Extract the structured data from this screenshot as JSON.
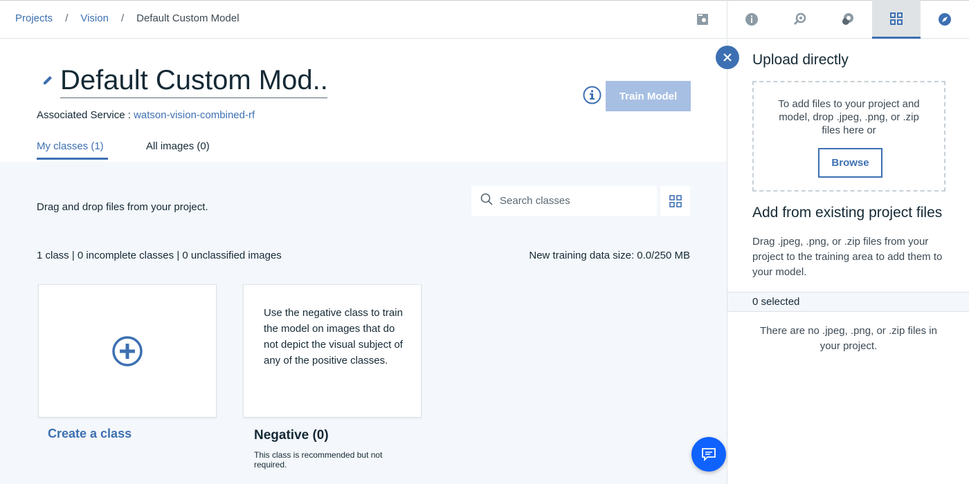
{
  "breadcrumb": {
    "items": [
      "Projects",
      "Vision"
    ],
    "separator": "/",
    "current": "Default Custom Model"
  },
  "toolbar_icons": [
    "assets-icon",
    "info-icon",
    "search-data-icon",
    "collaborate-icon",
    "data-panel-icon",
    "compass-icon"
  ],
  "header": {
    "title": "Default Custom Mod...",
    "associated_label": "Associated Service :",
    "associated_service": "watson-vision-combined-rf",
    "train_button": "Train Model"
  },
  "tabs": [
    {
      "label": "My classes (1)",
      "active": true
    },
    {
      "label": "All images (0)",
      "active": false
    }
  ],
  "content": {
    "drag_text": "Drag and drop files from your project.",
    "search_placeholder": "Search classes",
    "stats": "1 class | 0 incomplete classes | 0 unclassified images",
    "training_size": "New training data size: 0.0/250 MB",
    "create_label": "Create a class",
    "negative": {
      "description": "Use the negative class to train the model on images that do not depict the visual subject of any of the positive classes.",
      "title": "Negative (0)",
      "note": "This class is recommended but not required."
    }
  },
  "panel": {
    "upload_title": "Upload directly",
    "dropzone_text": "To add files to your project and model, drop .jpeg, .png, or .zip files here or",
    "browse_label": "Browse",
    "existing_title": "Add from existing project files",
    "existing_desc": "Drag .jpeg, .png, or .zip files from your project to the training area to add them to your model.",
    "selected": "0 selected",
    "empty_text": "There are no .jpeg, .png, or .zip files in your project."
  },
  "colors": {
    "accent": "#3d70b2",
    "train_disabled": "#a7bfe3",
    "chat_fab": "#0f62fe",
    "content_bg": "#f4f7fb"
  }
}
